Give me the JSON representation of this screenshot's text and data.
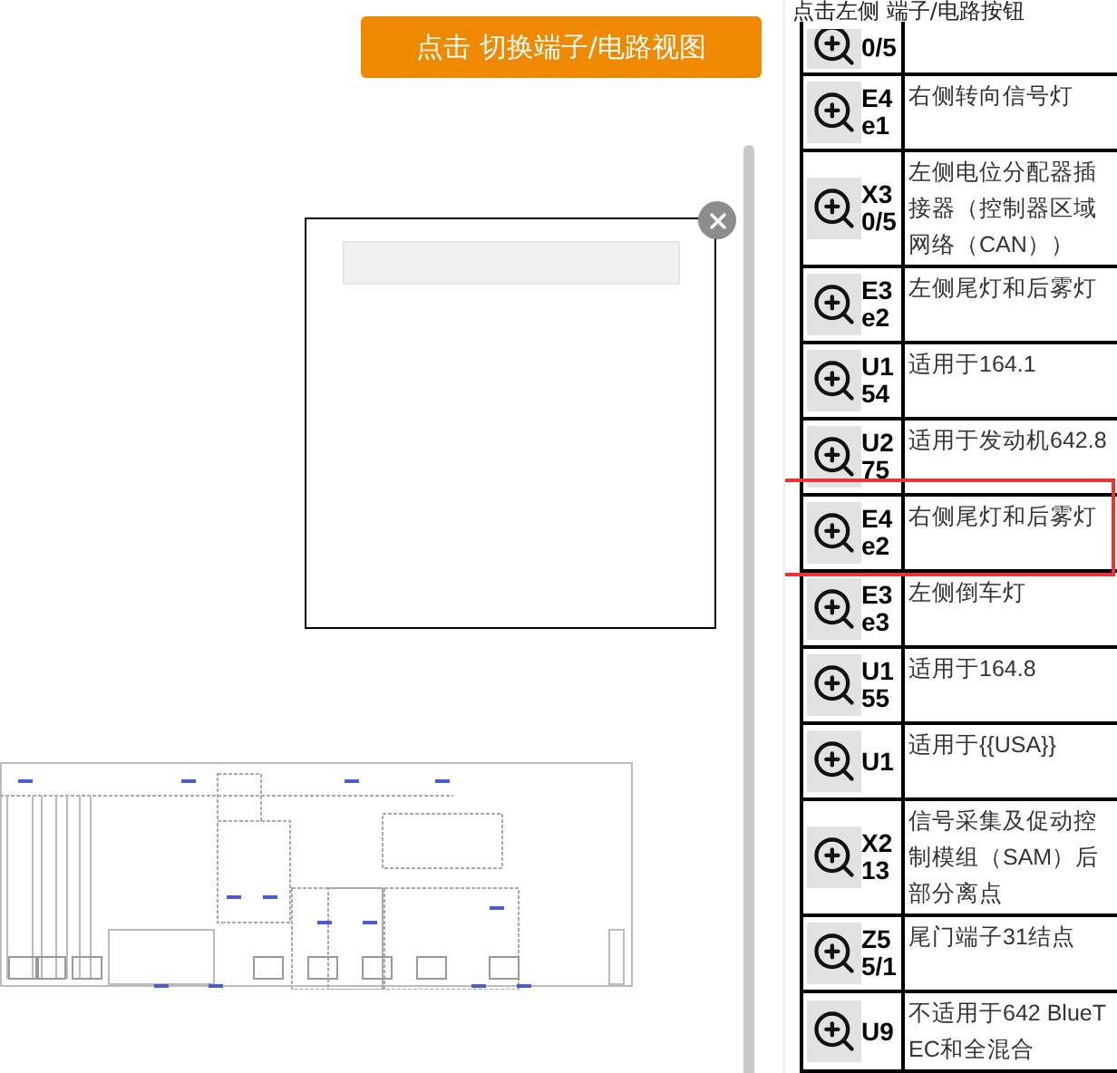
{
  "switch_button": {
    "label": "点击 切换端子/电路视图"
  },
  "popup": {
    "open": true
  },
  "panel": {
    "caption": "点击左侧 端子/电路按钮",
    "rows": [
      {
        "code_lines": [
          "0/5"
        ],
        "description": "",
        "selected": false
      },
      {
        "code_lines": [
          "E4",
          "e1"
        ],
        "description": "右侧转向信号灯",
        "selected": false
      },
      {
        "code_lines": [
          "X3",
          "0/5"
        ],
        "description": "左侧电位分配器插接器（控制器区域网络（CAN））",
        "selected": false
      },
      {
        "code_lines": [
          "E3",
          "e2"
        ],
        "description": "左侧尾灯和后雾灯",
        "selected": false
      },
      {
        "code_lines": [
          "U1",
          "54"
        ],
        "description": "适用于164.1",
        "selected": false
      },
      {
        "code_lines": [
          "U2",
          "75"
        ],
        "description": "适用于发动机642.8",
        "selected": false
      },
      {
        "code_lines": [
          "E4",
          "e2"
        ],
        "description": "右侧尾灯和后雾灯",
        "selected": true
      },
      {
        "code_lines": [
          "E3",
          "e3"
        ],
        "description": "左侧倒车灯",
        "selected": false
      },
      {
        "code_lines": [
          "U1",
          "55"
        ],
        "description": "适用于164.8",
        "selected": false
      },
      {
        "code_lines": [
          "U1"
        ],
        "description": "适用于{{USA}}",
        "selected": false
      },
      {
        "code_lines": [
          "X2",
          "13"
        ],
        "description": "信号采集及促动控制模组（SAM）后部分离点",
        "selected": false
      },
      {
        "code_lines": [
          "Z5",
          "5/1"
        ],
        "description": "尾门端子31结点",
        "selected": false
      },
      {
        "code_lines": [
          "U9"
        ],
        "description": "不适用于642 BlueTEC和全混合",
        "selected": false
      }
    ]
  }
}
